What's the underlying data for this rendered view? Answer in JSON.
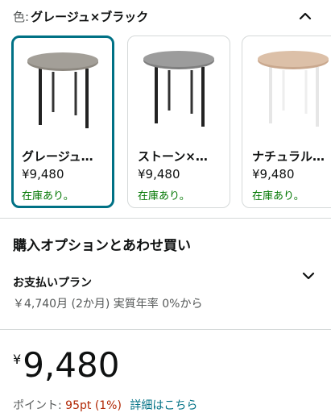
{
  "color_selector": {
    "prefix": "色:",
    "selected_name": "グレージュ×ブラック"
  },
  "swatches": [
    {
      "name": "グレージュ…",
      "price": "¥9,480",
      "stock": "在庫あり。",
      "selected": true
    },
    {
      "name": "ストーン×…",
      "price": "¥9,480",
      "stock": "在庫あり。",
      "selected": false
    },
    {
      "name": "ナチュラル…",
      "price": "¥9,480",
      "stock": "在庫あり。",
      "selected": false
    }
  ],
  "options": {
    "title": "購入オプションとあわせ買い"
  },
  "payment": {
    "title": "お支払いプラン",
    "subtitle": "￥4,740月 (2か月) 実質年率 0%から"
  },
  "price": {
    "symbol": "¥",
    "amount": "9,480"
  },
  "points": {
    "label": "ポイント:",
    "value": "95pt (1%)",
    "link": "詳細はこちら"
  },
  "colors": {
    "accent": "#007185",
    "in_stock": "#007600",
    "points": "#b12704"
  },
  "icons": {
    "collapse": "chevron-up-icon",
    "expand": "chevron-down-icon"
  }
}
